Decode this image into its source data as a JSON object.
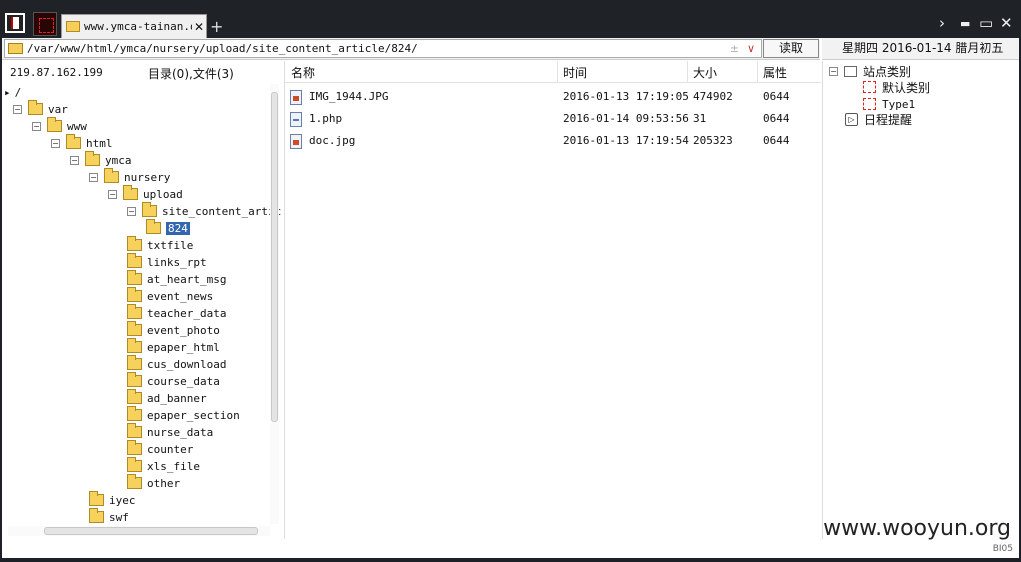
{
  "titlebar": {
    "tab_title": "www.ymca-tainan.o...",
    "tab_close": "✕",
    "new_tab": "+",
    "controls": {
      "back": "›",
      "minimize": "▬",
      "maximize": "▭",
      "close": "✕"
    }
  },
  "pathbar": {
    "path": "/var/www/html/ymca/nursery/upload/site_content_article/824/",
    "plus_minus": "±",
    "dropdown": "∨",
    "read_button": "读取"
  },
  "datebar": {
    "date": "星期四 2016-01-14 腊月初五"
  },
  "info": {
    "ip": "219.87.162.199",
    "counts": "目录(0),文件(3)"
  },
  "tree": [
    {
      "label": "/",
      "level": 0,
      "toggle": "",
      "folder": false
    },
    {
      "label": "var",
      "level": 1,
      "toggle": "-",
      "folder": true
    },
    {
      "label": "www",
      "level": 2,
      "toggle": "-",
      "folder": true
    },
    {
      "label": "html",
      "level": 3,
      "toggle": "-",
      "folder": true
    },
    {
      "label": "ymca",
      "level": 4,
      "toggle": "-",
      "folder": true
    },
    {
      "label": "nursery",
      "level": 5,
      "toggle": "-",
      "folder": true
    },
    {
      "label": "upload",
      "level": 6,
      "toggle": "-",
      "folder": true
    },
    {
      "label": "site_content_article",
      "level": 7,
      "toggle": "-",
      "folder": true
    },
    {
      "label": "824",
      "level": 8,
      "toggle": "",
      "folder": true,
      "selected": true
    },
    {
      "label": "txtfile",
      "level": 7,
      "toggle": "",
      "folder": true
    },
    {
      "label": "links_rpt",
      "level": 7,
      "toggle": "",
      "folder": true
    },
    {
      "label": "at_heart_msg",
      "level": 7,
      "toggle": "",
      "folder": true
    },
    {
      "label": "event_news",
      "level": 7,
      "toggle": "",
      "folder": true
    },
    {
      "label": "teacher_data",
      "level": 7,
      "toggle": "",
      "folder": true
    },
    {
      "label": "event_photo",
      "level": 7,
      "toggle": "",
      "folder": true
    },
    {
      "label": "epaper_html",
      "level": 7,
      "toggle": "",
      "folder": true
    },
    {
      "label": "cus_download",
      "level": 7,
      "toggle": "",
      "folder": true
    },
    {
      "label": "course_data",
      "level": 7,
      "toggle": "",
      "folder": true
    },
    {
      "label": "ad_banner",
      "level": 7,
      "toggle": "",
      "folder": true
    },
    {
      "label": "epaper_section",
      "level": 7,
      "toggle": "",
      "folder": true
    },
    {
      "label": "nurse_data",
      "level": 7,
      "toggle": "",
      "folder": true
    },
    {
      "label": "counter",
      "level": 7,
      "toggle": "",
      "folder": true
    },
    {
      "label": "xls_file",
      "level": 7,
      "toggle": "",
      "folder": true
    },
    {
      "label": "other",
      "level": 7,
      "toggle": "",
      "folder": true
    },
    {
      "label": "iyec",
      "level": 5,
      "toggle": "",
      "folder": true
    },
    {
      "label": "swf",
      "level": 5,
      "toggle": "",
      "folder": true
    }
  ],
  "list": {
    "headers": {
      "name": "名称",
      "time": "时间",
      "size": "大小",
      "attr": "属性"
    },
    "rows": [
      {
        "name": "IMG_1944.JPG",
        "time": "2016-01-13 17:19:05",
        "size": "474902",
        "attr": "0644",
        "icon": "image-file-icon"
      },
      {
        "name": "1.php",
        "time": "2016-01-14 09:53:56",
        "size": "31",
        "attr": "0644",
        "icon": "php-file-icon"
      },
      {
        "name": "doc.jpg",
        "time": "2016-01-13 17:19:54",
        "size": "205323",
        "attr": "0644",
        "icon": "image-file-icon"
      }
    ]
  },
  "side": {
    "root": "站点类别",
    "children": [
      "默认类别",
      "Type1"
    ],
    "reminder": "日程提醒"
  },
  "watermark": "www.wooyun.org",
  "corner_label": "BI05"
}
